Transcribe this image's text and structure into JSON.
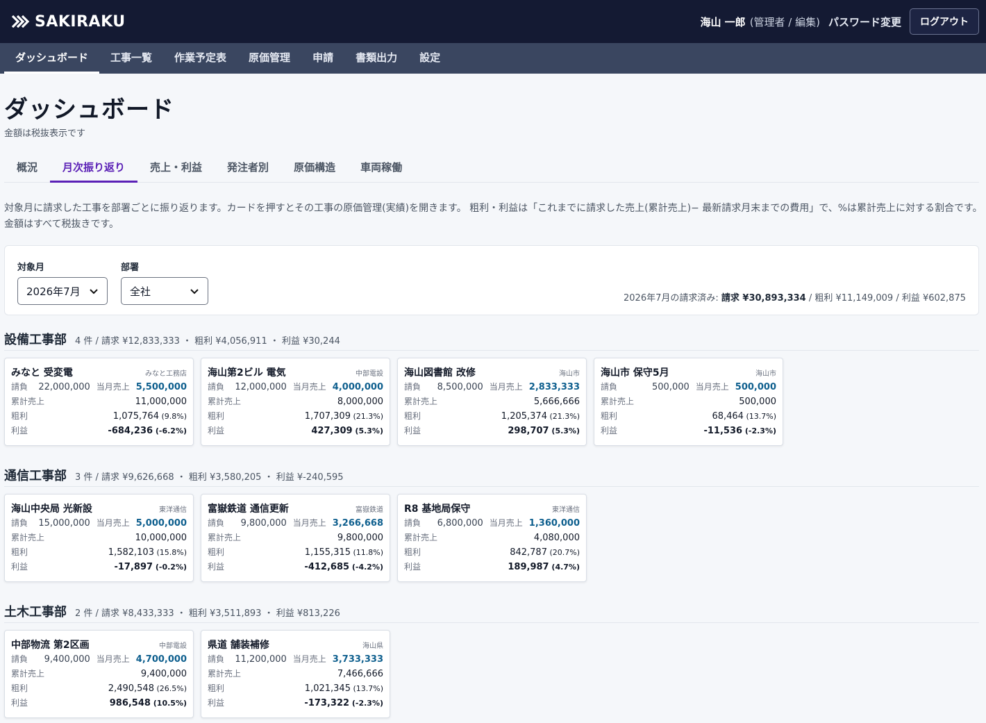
{
  "app": {
    "logo": "SAKIRAKU",
    "user_name": "海山 一郎",
    "user_role": "(管理者 / 編集)",
    "password_link": "パスワード変更",
    "logout": "ログアウト"
  },
  "nav": [
    "ダッシュボード",
    "工事一覧",
    "作業予定表",
    "原価管理",
    "申請",
    "書類出力",
    "設定"
  ],
  "page": {
    "title": "ダッシュボード",
    "subtitle": "金額は税抜表示です"
  },
  "tabs": [
    "概況",
    "月次振り返り",
    "売上・利益",
    "発注者別",
    "原価構造",
    "車両稼働"
  ],
  "description": "対象月に請求した工事を部署ごとに振り返ります。カードを押すとその工事の原価管理(実績)を開きます。 粗利・利益は「これまでに請求した売上(累計売上)− 最新請求月末までの費用」で、%は累計売上に対する割合です。 金額はすべて税抜きです。",
  "filters": {
    "month_label": "対象月",
    "month_value": "2026年7月",
    "dept_label": "部署",
    "dept_value": "全社",
    "summary_prefix": "2026年7月の請求済み: ",
    "summary_bold": "請求 ¥30,893,334",
    "summary_rest": " / 粗利 ¥11,149,009 / 利益 ¥602,875"
  },
  "labels": {
    "contract": "請負",
    "monthly_sales": "当月売上",
    "cumulative": "累計売上",
    "gross": "粗利",
    "profit": "利益"
  },
  "departments": [
    {
      "name": "設備工事部",
      "stats": "4 件 / 請求 ¥12,833,333 ・ 粗利 ¥4,056,911 ・ 利益 ¥30,244",
      "cards": [
        {
          "title": "みなと 受変電",
          "client": "みなと工務店",
          "contract": "22,000,000",
          "monthly": "5,500,000",
          "cumulative": "11,000,000",
          "gross": "1,075,764",
          "gross_pct": "(9.8%)",
          "profit": "-684,236",
          "profit_pct": "(-6.2%)",
          "profit_neg": true
        },
        {
          "title": "海山第2ビル 電気",
          "client": "中部電設",
          "contract": "12,000,000",
          "monthly": "4,000,000",
          "cumulative": "8,000,000",
          "gross": "1,707,309",
          "gross_pct": "(21.3%)",
          "profit": "427,309",
          "profit_pct": "(5.3%)",
          "profit_neg": false
        },
        {
          "title": "海山図書館 改修",
          "client": "海山市",
          "contract": "8,500,000",
          "monthly": "2,833,333",
          "cumulative": "5,666,666",
          "gross": "1,205,374",
          "gross_pct": "(21.3%)",
          "profit": "298,707",
          "profit_pct": "(5.3%)",
          "profit_neg": false
        },
        {
          "title": "海山市 保守5月",
          "client": "海山市",
          "contract": "500,000",
          "monthly": "500,000",
          "cumulative": "500,000",
          "gross": "68,464",
          "gross_pct": "(13.7%)",
          "profit": "-11,536",
          "profit_pct": "(-2.3%)",
          "profit_neg": true
        }
      ]
    },
    {
      "name": "通信工事部",
      "stats": "3 件 / 請求 ¥9,626,668 ・ 粗利 ¥3,580,205 ・ 利益 ¥-240,595",
      "cards": [
        {
          "title": "海山中央局 光新設",
          "client": "東洋通信",
          "contract": "15,000,000",
          "monthly": "5,000,000",
          "cumulative": "10,000,000",
          "gross": "1,582,103",
          "gross_pct": "(15.8%)",
          "profit": "-17,897",
          "profit_pct": "(-0.2%)",
          "profit_neg": true
        },
        {
          "title": "富嶽鉄道 通信更新",
          "client": "富嶽鉄道",
          "contract": "9,800,000",
          "monthly": "3,266,668",
          "cumulative": "9,800,000",
          "gross": "1,155,315",
          "gross_pct": "(11.8%)",
          "profit": "-412,685",
          "profit_pct": "(-4.2%)",
          "profit_neg": true
        },
        {
          "title": "R8 基地局保守",
          "client": "東洋通信",
          "contract": "6,800,000",
          "monthly": "1,360,000",
          "cumulative": "4,080,000",
          "gross": "842,787",
          "gross_pct": "(20.7%)",
          "profit": "189,987",
          "profit_pct": "(4.7%)",
          "profit_neg": false
        }
      ]
    },
    {
      "name": "土木工事部",
      "stats": "2 件 / 請求 ¥8,433,333 ・ 粗利 ¥3,511,893 ・ 利益 ¥813,226",
      "cards": [
        {
          "title": "中部物流 第2区画",
          "client": "中部電設",
          "contract": "9,400,000",
          "monthly": "4,700,000",
          "cumulative": "9,400,000",
          "gross": "2,490,548",
          "gross_pct": "(26.5%)",
          "profit": "986,548",
          "profit_pct": "(10.5%)",
          "profit_neg": false
        },
        {
          "title": "県道 舗装補修",
          "client": "海山県",
          "contract": "11,200,000",
          "monthly": "3,733,333",
          "cumulative": "7,466,666",
          "gross": "1,021,345",
          "gross_pct": "(13.7%)",
          "profit": "-173,322",
          "profit_pct": "(-2.3%)",
          "profit_neg": true
        }
      ]
    }
  ]
}
